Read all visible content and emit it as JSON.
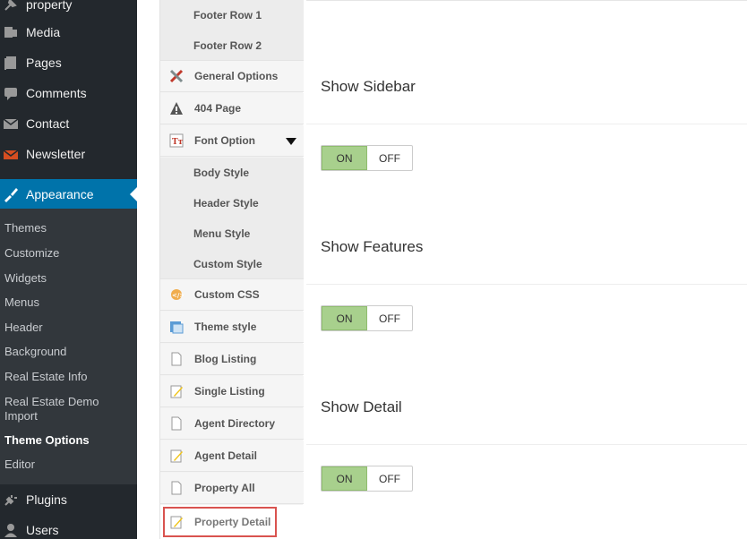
{
  "wp_menu": {
    "property": "property",
    "media": "Media",
    "pages": "Pages",
    "comments": "Comments",
    "contact": "Contact",
    "newsletter": "Newsletter",
    "appearance": "Appearance",
    "plugins": "Plugins",
    "users": "Users"
  },
  "appearance_submenu": {
    "themes": "Themes",
    "customize": "Customize",
    "widgets": "Widgets",
    "menus": "Menus",
    "header": "Header",
    "background": "Background",
    "real_estate_info": "Real Estate Info",
    "real_estate_demo_import": "Real Estate Demo Import",
    "theme_options": "Theme Options",
    "editor": "Editor"
  },
  "options_nav": {
    "footer_row_1": "Footer Row 1",
    "footer_row_2": "Footer Row 2",
    "general_options": "General Options",
    "page_404": "404 Page",
    "font_option": "Font Option",
    "body_style": "Body Style",
    "header_style": "Header Style",
    "menu_style": "Menu Style",
    "custom_style": "Custom Style",
    "custom_css": "Custom CSS",
    "theme_style": "Theme style",
    "blog_listing": "Blog Listing",
    "single_listing": "Single Listing",
    "agent_directory": "Agent Directory",
    "agent_detail": "Agent Detail",
    "property_all": "Property All",
    "property_detail": "Property Detail"
  },
  "fields": {
    "show_sidebar": {
      "title": "Show Sidebar",
      "on": "ON",
      "off": "OFF"
    },
    "show_features": {
      "title": "Show Features",
      "on": "ON",
      "off": "OFF"
    },
    "show_detail": {
      "title": "Show Detail",
      "on": "ON",
      "off": "OFF"
    }
  },
  "colors": {
    "accent": "#0073aa",
    "toggle_on": "#a8d08d",
    "highlight": "#d9534f"
  }
}
